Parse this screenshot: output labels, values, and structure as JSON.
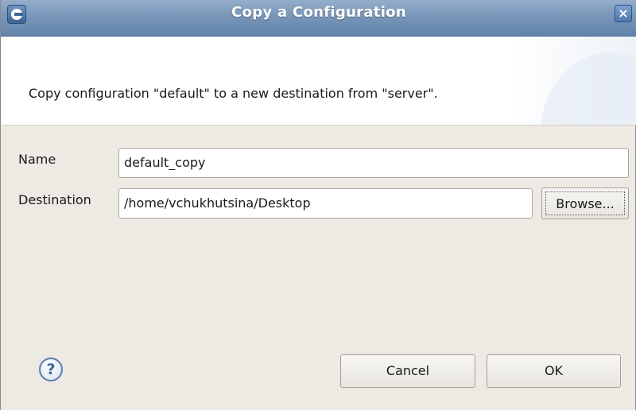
{
  "window": {
    "title": "Copy a Configuration",
    "close_glyph": "×",
    "app_icon": "eclipse-icon"
  },
  "header": {
    "message": "Copy configuration \"default\" to a new destination from \"server\"."
  },
  "form": {
    "name_label": "Name",
    "name_value": "default_copy",
    "destination_label": "Destination",
    "destination_value": "/home/vchukhutsina/Desktop",
    "browse_label": "Browse..."
  },
  "footer": {
    "help_glyph": "?",
    "help_icon": "help-icon",
    "cancel_label": "Cancel",
    "ok_label": "OK"
  },
  "colors": {
    "titlebar": "#7896b8",
    "dialog_background": "#ede9e3",
    "header_background": "#ffffff"
  }
}
